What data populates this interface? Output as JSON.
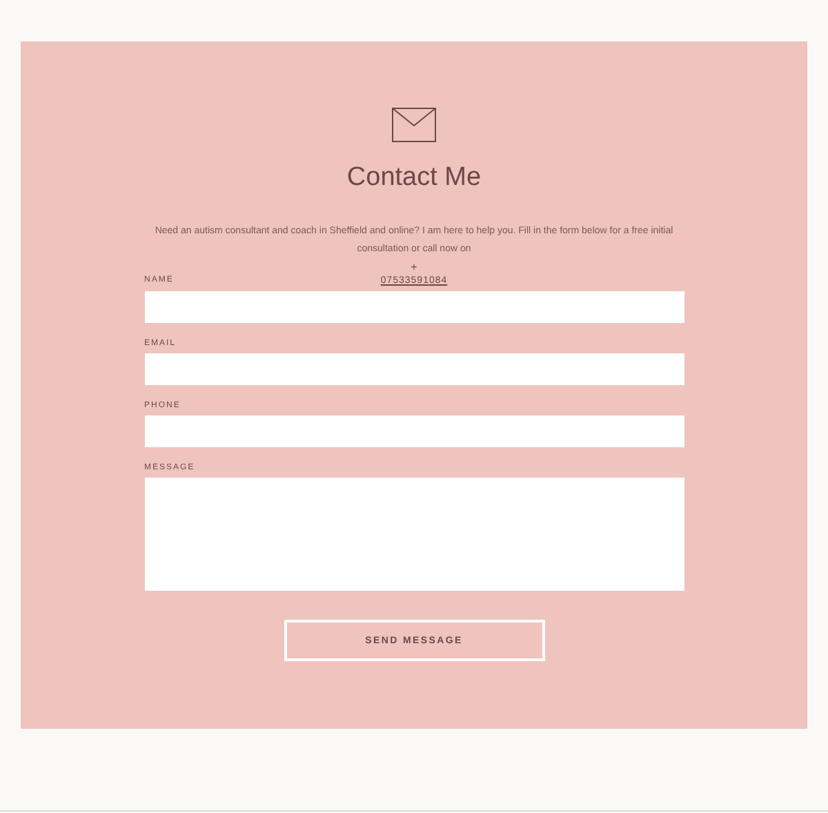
{
  "title": "Contact Me",
  "intro": "Need an autism consultant and coach in Sheffield and online? I am here to help you. Fill in the form below for a free initial consultation or call now on",
  "phone_prefix": "+",
  "phone": "07533591084",
  "fields": [
    {
      "label": "NAME",
      "kind": "line"
    },
    {
      "label": "EMAIL",
      "kind": "line"
    },
    {
      "label": "PHONE",
      "kind": "line"
    },
    {
      "label": "MESSAGE",
      "kind": "area"
    }
  ],
  "button": "SEND MESSAGE"
}
